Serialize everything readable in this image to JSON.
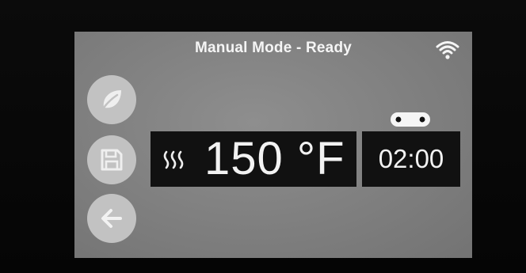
{
  "header": {
    "title": "Manual Mode - Ready",
    "wifi_icon": "wifi-icon"
  },
  "side_buttons": [
    {
      "icon": "leaf-icon",
      "action": "eco"
    },
    {
      "icon": "floppy-disk-icon",
      "action": "save"
    },
    {
      "icon": "arrow-left-icon",
      "action": "back"
    }
  ],
  "temperature": {
    "icon": "heat-waves-icon",
    "value": "150 °F"
  },
  "timer": {
    "icon": "conveyor-icon",
    "value": "02:00"
  },
  "colors": {
    "screen": "#808080",
    "panel": "#111111",
    "button": "#c2c2c2",
    "text": "#f2f2f2"
  }
}
